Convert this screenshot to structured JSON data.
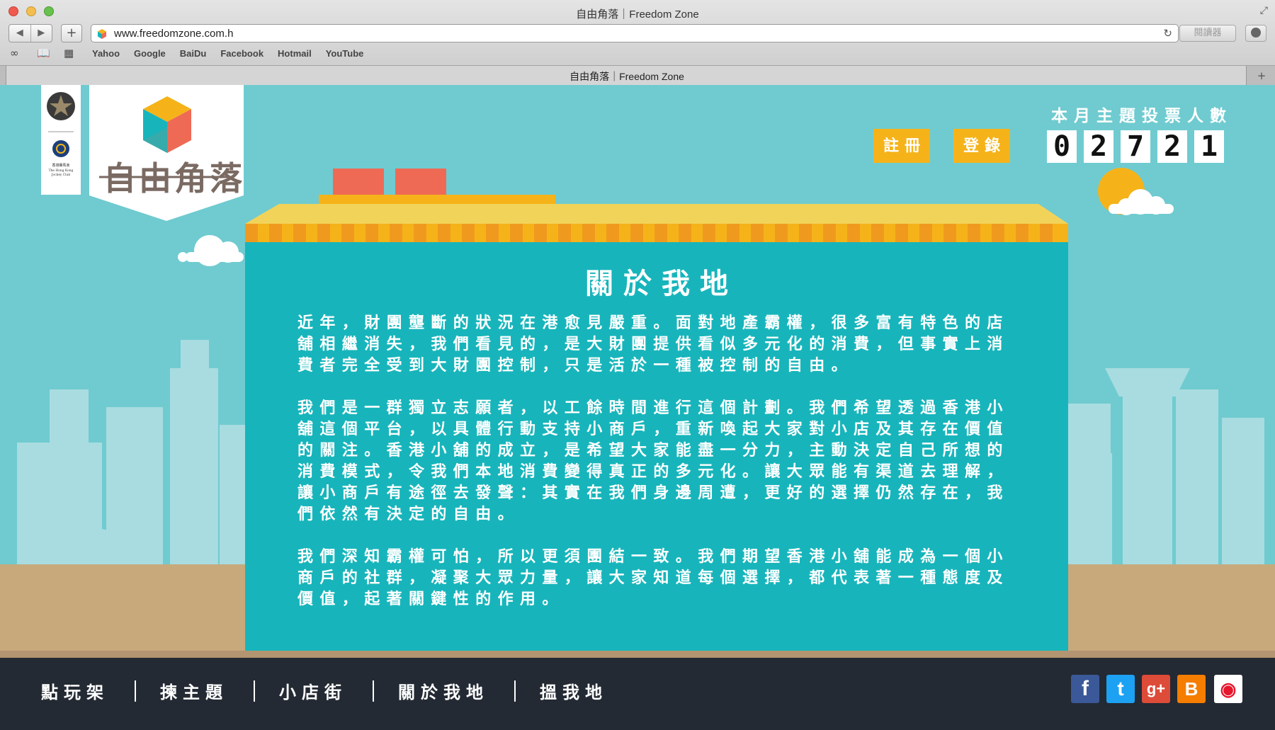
{
  "browser": {
    "window_title": "自由角落｜Freedom Zone",
    "url": "www.freedomzone.com.h",
    "reader_label": "閱讀器",
    "bookmarks": [
      "Yahoo",
      "Google",
      "BaiDu",
      "Facebook",
      "Hotmail",
      "YouTube"
    ],
    "tab_title": "自由角落｜Freedom Zone"
  },
  "site": {
    "logo_text": "自由角落",
    "sponsor_name": "The Hong Kong Jockey Club",
    "sponsor_cn": "香港賽馬會",
    "buttons": {
      "register": "註冊",
      "login": "登錄"
    },
    "vote_counter": {
      "label": "本月主題投票人數",
      "digits": [
        "0",
        "2",
        "7",
        "2",
        "1"
      ]
    },
    "about": {
      "title": "關於我地",
      "paragraphs": [
        "近年，財團壟斷的狀況在港愈見嚴重。面對地產霸權，很多富有特色的店舖相繼消失，我們看見的，是大財團提供看似多元化的消費，但事實上消費者完全受到大財團控制，只是活於一種被控制的自由。",
        "我們是一群獨立志願者，以工餘時間進行這個計劃。我們希望透過香港小舖這個平台，以具體行動支持小商戶，重新喚起大家對小店及其存在價值的關注。香港小舖的成立，是希望大家能盡一分力，主動決定自己所想的消費模式，令我們本地消費變得真正的多元化。讓大眾能有渠道去理解，讓小商戶有途徑去發聲：其實在我們身邊周遭，更好的選擇仍然存在，我們依然有決定的自由。",
        "我們深知霸權可怕，所以更須團結一致。我們期望香港小舖能成為一個小商戶的社群，凝聚大眾力量，讓大家知道每個選擇，都代表著一種態度及價值，起著關鍵性的作用。"
      ]
    },
    "nav": [
      "點玩架",
      "揀主題",
      "小店街",
      "關於我地",
      "搵我地"
    ],
    "social": [
      {
        "name": "facebook-icon",
        "glyph": "f",
        "color": "#3b5998"
      },
      {
        "name": "twitter-icon",
        "glyph": "t",
        "color": "#1da1f2"
      },
      {
        "name": "googleplus-icon",
        "glyph": "g+",
        "color": "#dd4b39"
      },
      {
        "name": "blogger-icon",
        "glyph": "B",
        "color": "#f57d00"
      },
      {
        "name": "weibo-icon",
        "glyph": "◉",
        "color": "#ffffff"
      }
    ],
    "colors": {
      "sky": "#6fcbd0",
      "card": "#17b5bb",
      "accent_yellow": "#f5b319",
      "footer": "#232a33"
    }
  }
}
